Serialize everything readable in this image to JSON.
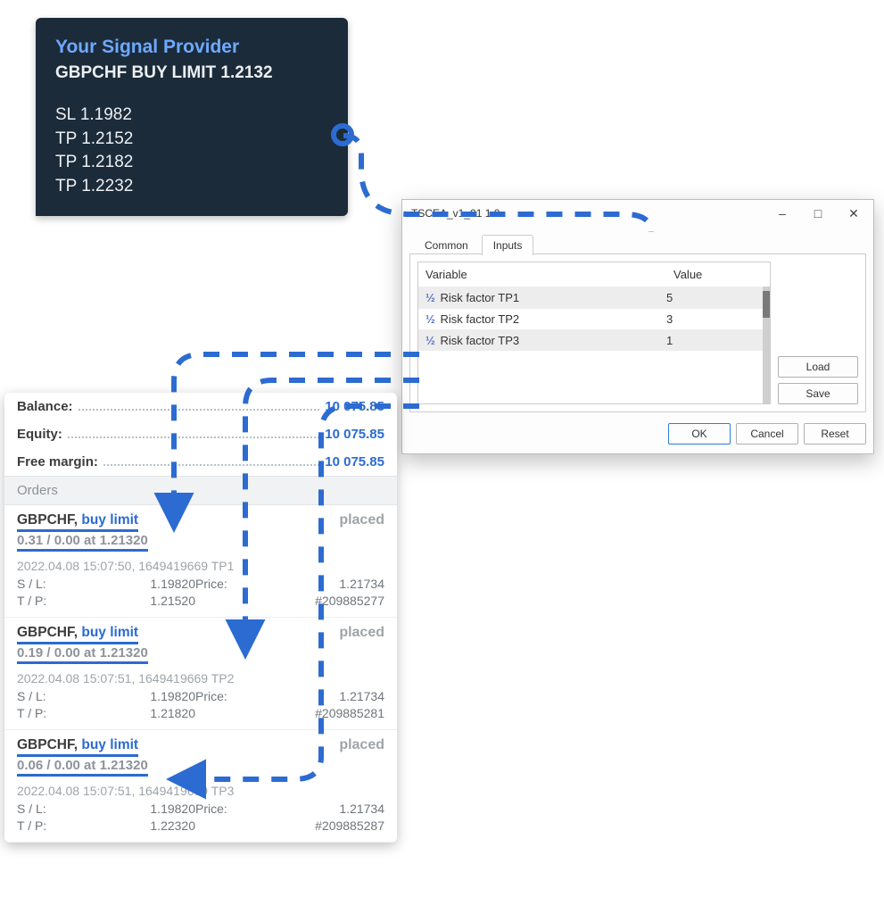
{
  "signal": {
    "provider": "Your Signal Provider",
    "headline": "GBPCHF BUY LIMIT 1.2132",
    "lines": [
      "SL 1.1982",
      "TP 1.2152",
      "TP 1.2182",
      "TP 1.2232"
    ]
  },
  "dialog": {
    "title": "TSCEA_v1_01 1.0",
    "tabs": {
      "common": "Common",
      "inputs": "Inputs"
    },
    "columns": {
      "variable": "Variable",
      "value": "Value"
    },
    "rows": [
      {
        "name": "Risk factor TP1",
        "value": "5"
      },
      {
        "name": "Risk factor TP2",
        "value": "3"
      },
      {
        "name": "Risk factor TP3",
        "value": "1"
      }
    ],
    "buttons": {
      "load": "Load",
      "save": "Save",
      "ok": "OK",
      "cancel": "Cancel",
      "reset": "Reset"
    }
  },
  "account": {
    "balance": {
      "label": "Balance:",
      "value": "10 075.85"
    },
    "equity": {
      "label": "Equity:",
      "value": "10 075.85"
    },
    "free_margin": {
      "label": "Free margin:",
      "value": "10 075.85"
    },
    "orders_header": "Orders"
  },
  "orders": [
    {
      "symbol": "GBPCHF,",
      "type": "buy limit",
      "status": "placed",
      "lots": "0.31 / 0.00 at 1.21320",
      "meta": "2022.04.08 15:07:50, 1649419669  TP1",
      "sl": "1.19820",
      "price": "1.21734",
      "tp": "1.21520",
      "id": "#209885277"
    },
    {
      "symbol": "GBPCHF,",
      "type": "buy limit",
      "status": "placed",
      "lots": "0.19 / 0.00 at 1.21320",
      "meta": "2022.04.08 15:07:51, 1649419669  TP2",
      "sl": "1.19820",
      "price": "1.21734",
      "tp": "1.21820",
      "id": "#209885281"
    },
    {
      "symbol": "GBPCHF,",
      "type": "buy limit",
      "status": "placed",
      "lots": "0.06 / 0.00 at 1.21320",
      "meta": "2022.04.08 15:07:51, 1649419669  TP3",
      "sl": "1.19820",
      "price": "1.21734",
      "tp": "1.22320",
      "id": "#209885287"
    }
  ],
  "labels": {
    "sl": "S / L:",
    "tp": "T / P:",
    "price": "Price:"
  }
}
